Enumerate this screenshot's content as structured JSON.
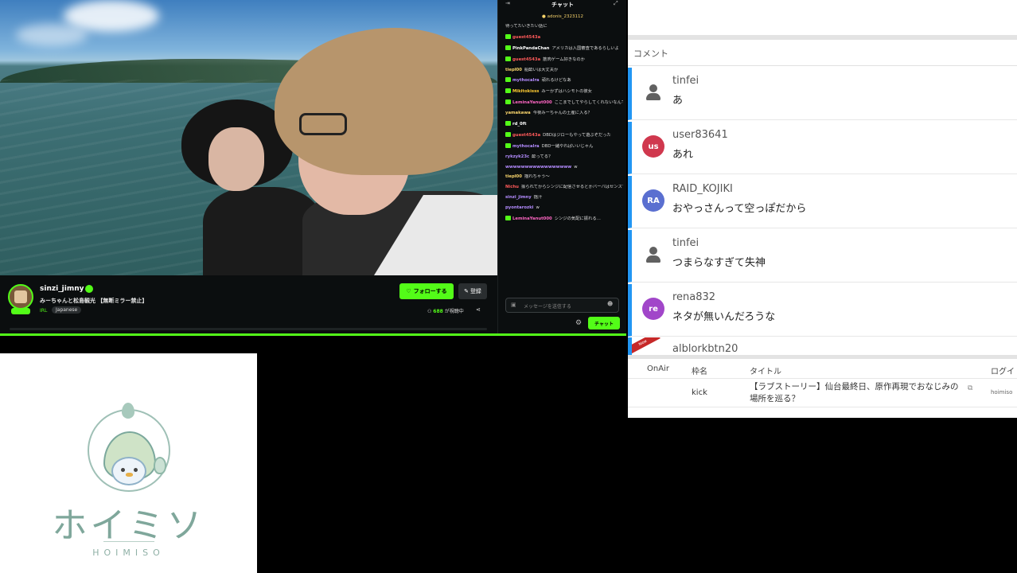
{
  "stream": {
    "streamer_name": "sinzi_jimny",
    "title": "みーちゃんと松島観光 【無断ミラー禁止】",
    "category": "IRL",
    "language": "Japanese",
    "follow_label": "フォローする",
    "subscribe_label": "登録",
    "viewer_count": "688",
    "viewer_suffix": "が視聴中"
  },
  "chat": {
    "title": "チャット",
    "pinned": "adonis_2323112 ",
    "input_placeholder": "メッセージを送信する",
    "send_label": "チャット",
    "messages": [
      {
        "user": "",
        "text": "待ってたいきたい話に",
        "color": "#dddddd",
        "badge": false
      },
      {
        "user": "guest4543a",
        "text": "",
        "color": "#ff5a5a",
        "badge": true
      },
      {
        "user": "PinkPandaChan",
        "text": "アメリカは入国審査であるらしいよ",
        "color": "#ffffff",
        "badge": true
      },
      {
        "user": "guest4543a",
        "text": "筋肉ゲーム好きなのか",
        "color": "#ff5a5a",
        "badge": true
      },
      {
        "user": "tiepl00",
        "text": "船酔いは大丈夫か",
        "color": "#f7d36b",
        "badge": false
      },
      {
        "user": "mythocalra",
        "text": "頑れるけどなあ",
        "color": "#b48cff",
        "badge": true
      },
      {
        "user": "Mikitokisss",
        "text": "みーかずはハシモトの彼女",
        "color": "#ffcc33",
        "badge": true
      },
      {
        "user": "LeminaYanut000",
        "text": "ここまでしてやらしてくれないなんてないよな？みーかずさんよぉ？",
        "color": "#ff66c4",
        "badge": true
      },
      {
        "user": "yamakawa",
        "text": "今夜みーちゃんの土産に入る？",
        "color": "#f7d36b",
        "badge": false
      },
      {
        "user": "rd_0ft",
        "text": "",
        "color": "#ffffff",
        "badge": true
      },
      {
        "user": "guest4543a",
        "text": "DBDはジローもやって遊ぶぞだった",
        "color": "#ff5a5a",
        "badge": true
      },
      {
        "user": "mythocalra",
        "text": "DBD一緒やればいいじゃん",
        "color": "#b48cff",
        "badge": true
      },
      {
        "user": "rykzyk23c",
        "text": "酔ってる？",
        "color": "#b48cff",
        "badge": false
      },
      {
        "user": "wwwwwwwwwwwwwwwww",
        "text": "w",
        "color": "#b48cff",
        "badge": false
      },
      {
        "user": "tiepl00",
        "text": "揺れちゃう〜",
        "color": "#f7d36b",
        "badge": false
      },
      {
        "user": "Nichu",
        "text": "振られてからシンジに配信させるとかバーバはセンスすぎす",
        "color": "#ff5a5a",
        "badge": false
      },
      {
        "user": "sinzi_jimny",
        "text": "揺汁",
        "color": "#b48cff",
        "badge": false
      },
      {
        "user": "pyontarozki",
        "text": "w",
        "color": "#b48cff",
        "badge": false
      },
      {
        "user": "LeminaYanut000",
        "text": "シンジの気配に振れる…",
        "color": "#ff66c4",
        "badge": true
      }
    ]
  },
  "comments": {
    "header": "コメント",
    "rows": [
      {
        "user": "tinfei",
        "text": "あ",
        "avatar": "",
        "avatar_color": ""
      },
      {
        "user": "user83641",
        "text": "あれ",
        "avatar": "us",
        "avatar_color": "#d0384e"
      },
      {
        "user": "RAID_KOJIKI",
        "text": "おやっさんって空っぽだから",
        "avatar": "RA",
        "avatar_color": "#5a6fd0"
      },
      {
        "user": "tinfei",
        "text": "つまらなすぎて失神",
        "avatar": "",
        "avatar_color": ""
      },
      {
        "user": "rena832",
        "text": "ネタが無いんだろうな",
        "avatar": "re",
        "avatar_color": "#a146c9"
      }
    ],
    "last_user": "alblorkbtn20",
    "ribbon": "New"
  },
  "table": {
    "headers": [
      "OnAir",
      "枠名",
      "タイトル",
      "ログイ"
    ],
    "rows": [
      {
        "onair": "",
        "name": "kick",
        "title": "【ラブストーリー】仙台最終日、原作再現でおなじみの場所を巡る？",
        "log": "hoimiso"
      }
    ]
  },
  "logo": {
    "text": "ホイミソ",
    "subtitle": "HOIMISO"
  }
}
